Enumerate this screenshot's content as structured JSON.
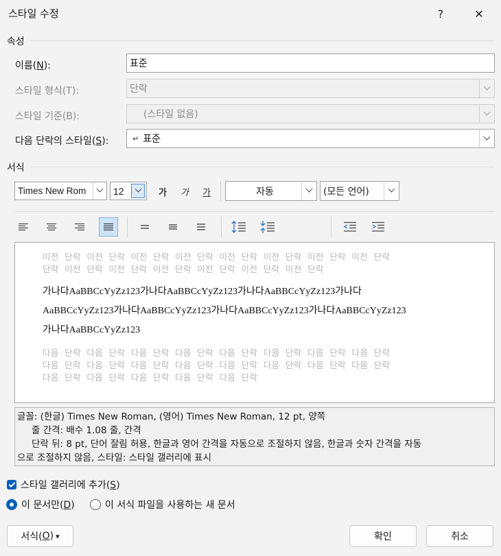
{
  "window": {
    "title": "스타일 수정",
    "help_glyph": "?",
    "close_glyph": "✕"
  },
  "properties": {
    "section_label": "속성",
    "name": {
      "label": "이름(",
      "mnemonic": "N",
      "label_end": "):",
      "value": "표준"
    },
    "style_type": {
      "label": "스타일 형식(T):",
      "value": "단락"
    },
    "based_on": {
      "label": "스타일 기준(B):",
      "value": "(스타일 없음)"
    },
    "next_style": {
      "label": "다음 단락의 스타일(",
      "mnemonic": "S",
      "label_end": "):",
      "value": "표준",
      "prefix_glyph": "↵"
    }
  },
  "formatting": {
    "section_label": "서식",
    "font_name": "Times New Rom",
    "font_size": "12",
    "bold_glyph": "가",
    "italic_glyph": "가",
    "underline_glyph": "가",
    "color": "자동",
    "language": "(모든 언어)"
  },
  "preview": {
    "prev_lines": [
      "이전 단락 이전 단락 이전 단락 이전 단락 이전 단락 이전 단락 이전 단락 이전 단락",
      "단락 이전 단락 이전 단락 이전 단락 이전 단락 이전 단락 이전 단락"
    ],
    "sample_lines": [
      "가나다AaBBCcYyZz123가나다AaBBCcYyZz123가나다AaBBCcYyZz123가나다",
      "AaBBCcYyZz123가나다AaBBCcYyZz123가나다AaBBCcYyZz123가나다AaBBCcYyZz123",
      "가나다AaBBCcYyZz123"
    ],
    "next_lines": [
      "다음 단락 다음 단락 다음 단락 다음 단락 다음 단락 다음 단락 다음 단락 다음 단락",
      "다음 단락 다음 단락 다음 단락 다음 단락 다음 단락 다음 단락 다음 단락 다음 단락",
      "다음 단락 다음 단락 다음 단락 다음 단락 다음 단락"
    ]
  },
  "description": {
    "line1": "글꼴: (한글) Times New Roman, (영어) Times New Roman, 12 pt, 양쪽",
    "line2": "줄 간격: 배수 1.08 줄, 간격",
    "line3": "단락 뒤: 8 pt, 단어 잘림 허용, 한글과 영어 간격을 자동으로 조절하지 않음, 한글과 숫자 간격을 자동",
    "line4": "으로 조절하지 않음, 스타일: 스타일 갤러리에 표시"
  },
  "options": {
    "add_to_gallery": {
      "label": "스타일 갤러리에 추가(",
      "mnemonic": "S",
      "label_end": ")",
      "checked": true
    },
    "this_document_only": {
      "label": "이 문서만(",
      "mnemonic": "D",
      "label_end": ")",
      "selected": true
    },
    "new_documents": {
      "label": "이 서식 파일을 사용하는 새 문서",
      "selected": false
    }
  },
  "buttons": {
    "format": {
      "label": "서식(",
      "mnemonic": "O",
      "label_end": ")",
      "caret": "▾"
    },
    "ok": "확인",
    "cancel": "취소"
  },
  "colors": {
    "accent": "#005fb8",
    "background": "#f3f3f3"
  }
}
